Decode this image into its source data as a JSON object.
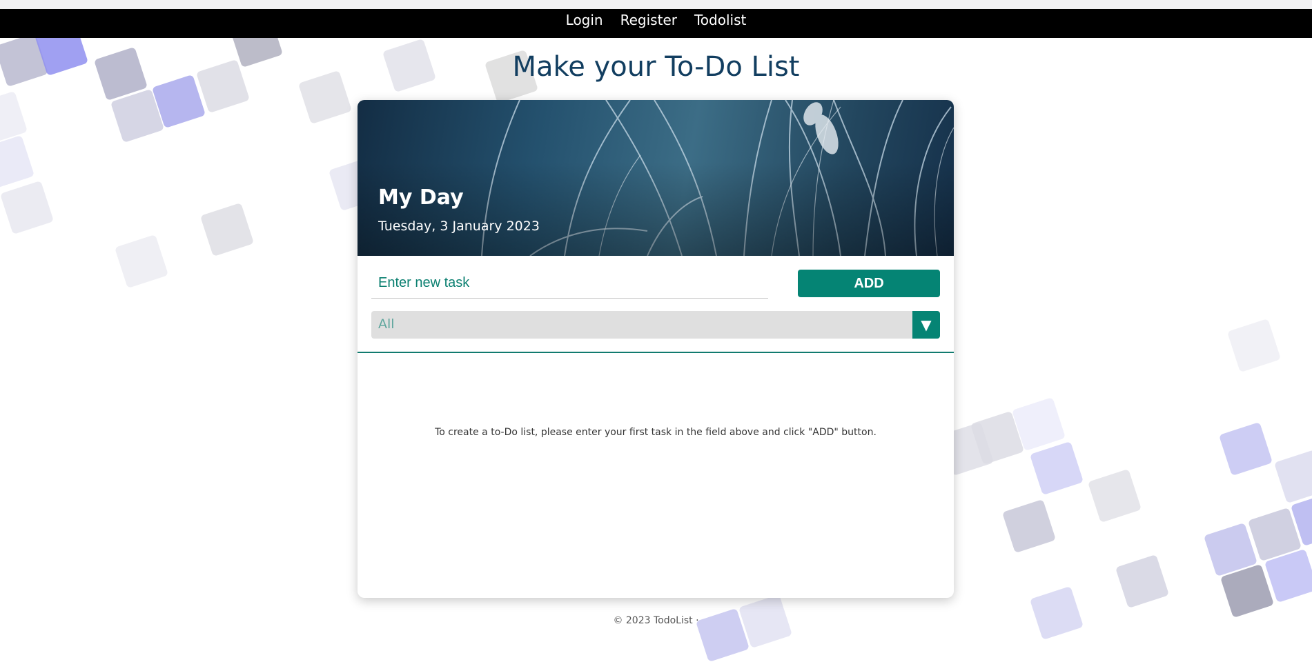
{
  "nav": {
    "links": [
      "Login",
      "Register",
      "Todolist"
    ]
  },
  "page": {
    "title": "Make your To-Do List"
  },
  "card": {
    "hero_title": "My Day",
    "hero_date": "Tuesday, 3 January 2023",
    "input_placeholder": "Enter new task",
    "add_label": "ADD",
    "filter_value": "All",
    "filter_arrow": "▼",
    "empty_message": "To create a to-Do list, please enter your first task in the field above and click \"ADD\" button."
  },
  "footer": {
    "text": "© 2023 TodoList ·"
  },
  "colors": {
    "accent": "#058474",
    "title": "#123e60",
    "navbar": "#000000"
  },
  "icons": {
    "filter_arrow": "triangle-down"
  }
}
